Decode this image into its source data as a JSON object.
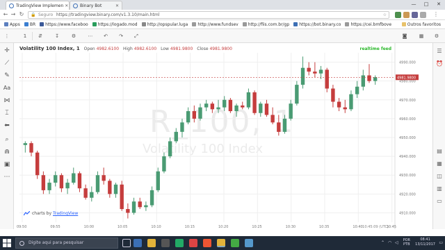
{
  "browser": {
    "tabs": [
      {
        "label": "TradingView Implemen",
        "active": true
      },
      {
        "label": "Binary Bot",
        "active": false
      }
    ],
    "secure_label": "Seguro",
    "url": "https://tradingview.binary.com/v1.3.10/main.html",
    "window_controls": [
      "—",
      "□",
      "✕"
    ]
  },
  "bookmarks": {
    "items": [
      "Apps",
      "BR",
      "https://www.faceboo",
      "https://logado.mod",
      "http://opspular.luga",
      "http://www.fundsev",
      "http://fiis.com.br/gp",
      "https://bot.binary.co",
      "https://cei.bmfbove"
    ],
    "right": "Outros favoritos"
  },
  "chart_toolbar": {
    "interval": "1",
    "symbols": [
      "⇵",
      "↧",
      "⚙",
      "⋯",
      "⤢"
    ]
  },
  "chart": {
    "legend": {
      "symbol": "Volatility 100 Index, 1",
      "open_label": "Open",
      "open": "4982.6100",
      "high_label": "High",
      "high": "4982.6100",
      "low_label": "Low",
      "low": "4981.9800",
      "close_label": "Close",
      "close": "4981.9800"
    },
    "realtime": "realtime feed",
    "watermark_symbol": "R_100, 1",
    "watermark_name": "Volatility 100 Index",
    "brand_prefix": "charts by",
    "brand_name": "TradingView",
    "timestamp": "10:45:09 (UTC)",
    "last_price_label": "4981.9800"
  },
  "chart_data": {
    "type": "candlestick",
    "title": "Volatility 100 Index, 1",
    "x_ticks": [
      "09:50",
      "09:55",
      "10:00",
      "10:05",
      "10:10",
      "10:15",
      "10:20",
      "10:25",
      "10:30",
      "10:35",
      "10:40",
      "10:45"
    ],
    "y_ticks": [
      4990,
      4980,
      4970,
      4960,
      4950,
      4940,
      4930,
      4920,
      4910
    ],
    "ylim": [
      4905,
      4995
    ],
    "last_price": 4981.98,
    "candles": [
      {
        "o": 4946,
        "h": 4948,
        "l": 4942,
        "c": 4947
      },
      {
        "o": 4947,
        "h": 4948,
        "l": 4940,
        "c": 4942
      },
      {
        "o": 4942,
        "h": 4943,
        "l": 4928,
        "c": 4930
      },
      {
        "o": 4930,
        "h": 4932,
        "l": 4920,
        "c": 4922
      },
      {
        "o": 4922,
        "h": 4928,
        "l": 4920,
        "c": 4926
      },
      {
        "o": 4926,
        "h": 4932,
        "l": 4924,
        "c": 4930
      },
      {
        "o": 4930,
        "h": 4931,
        "l": 4921,
        "c": 4923
      },
      {
        "o": 4923,
        "h": 4928,
        "l": 4920,
        "c": 4926
      },
      {
        "o": 4926,
        "h": 4934,
        "l": 4925,
        "c": 4931
      },
      {
        "o": 4931,
        "h": 4932,
        "l": 4921,
        "c": 4923
      },
      {
        "o": 4923,
        "h": 4925,
        "l": 4917,
        "c": 4918
      },
      {
        "o": 4918,
        "h": 4924,
        "l": 4916,
        "c": 4921
      },
      {
        "o": 4921,
        "h": 4932,
        "l": 4920,
        "c": 4930
      },
      {
        "o": 4930,
        "h": 4934,
        "l": 4925,
        "c": 4927
      },
      {
        "o": 4927,
        "h": 4928,
        "l": 4918,
        "c": 4920
      },
      {
        "o": 4920,
        "h": 4926,
        "l": 4918,
        "c": 4925
      },
      {
        "o": 4925,
        "h": 4927,
        "l": 4911,
        "c": 4912
      },
      {
        "o": 4912,
        "h": 4915,
        "l": 4907,
        "c": 4910
      },
      {
        "o": 4910,
        "h": 4918,
        "l": 4909,
        "c": 4916
      },
      {
        "o": 4916,
        "h": 4918,
        "l": 4912,
        "c": 4913
      },
      {
        "o": 4913,
        "h": 4916,
        "l": 4911,
        "c": 4914
      },
      {
        "o": 4914,
        "h": 4924,
        "l": 4913,
        "c": 4922
      },
      {
        "o": 4922,
        "h": 4934,
        "l": 4921,
        "c": 4932
      },
      {
        "o": 4932,
        "h": 4942,
        "l": 4931,
        "c": 4940
      },
      {
        "o": 4940,
        "h": 4950,
        "l": 4939,
        "c": 4948
      },
      {
        "o": 4948,
        "h": 4955,
        "l": 4947,
        "c": 4953
      },
      {
        "o": 4953,
        "h": 4960,
        "l": 4950,
        "c": 4958
      },
      {
        "o": 4958,
        "h": 4966,
        "l": 4957,
        "c": 4964
      },
      {
        "o": 4964,
        "h": 4967,
        "l": 4958,
        "c": 4960
      },
      {
        "o": 4960,
        "h": 4968,
        "l": 4959,
        "c": 4966
      },
      {
        "o": 4966,
        "h": 4970,
        "l": 4964,
        "c": 4968
      },
      {
        "o": 4968,
        "h": 4969,
        "l": 4963,
        "c": 4965
      },
      {
        "o": 4965,
        "h": 4970,
        "l": 4963,
        "c": 4966
      },
      {
        "o": 4966,
        "h": 4972,
        "l": 4964,
        "c": 4970
      },
      {
        "o": 4970,
        "h": 4971,
        "l": 4963,
        "c": 4964
      },
      {
        "o": 4964,
        "h": 4968,
        "l": 4961,
        "c": 4967
      },
      {
        "o": 4967,
        "h": 4969,
        "l": 4965,
        "c": 4966
      },
      {
        "o": 4966,
        "h": 4976,
        "l": 4965,
        "c": 4974
      },
      {
        "o": 4974,
        "h": 4975,
        "l": 4962,
        "c": 4963
      },
      {
        "o": 4963,
        "h": 4969,
        "l": 4961,
        "c": 4968
      },
      {
        "o": 4968,
        "h": 4970,
        "l": 4961,
        "c": 4962
      },
      {
        "o": 4962,
        "h": 4966,
        "l": 4957,
        "c": 4958
      },
      {
        "o": 4958,
        "h": 4962,
        "l": 4951,
        "c": 4953
      },
      {
        "o": 4953,
        "h": 4962,
        "l": 4952,
        "c": 4960
      },
      {
        "o": 4960,
        "h": 4970,
        "l": 4959,
        "c": 4968
      },
      {
        "o": 4968,
        "h": 4980,
        "l": 4967,
        "c": 4978
      },
      {
        "o": 4978,
        "h": 4993,
        "l": 4976,
        "c": 4987
      },
      {
        "o": 4987,
        "h": 4990,
        "l": 4983,
        "c": 4985
      },
      {
        "o": 4985,
        "h": 4990,
        "l": 4982,
        "c": 4984
      },
      {
        "o": 4984,
        "h": 4988,
        "l": 4981,
        "c": 4986
      },
      {
        "o": 4986,
        "h": 4987,
        "l": 4974,
        "c": 4976
      },
      {
        "o": 4976,
        "h": 4978,
        "l": 4966,
        "c": 4969
      },
      {
        "o": 4969,
        "h": 4971,
        "l": 4964,
        "c": 4966
      },
      {
        "o": 4966,
        "h": 4970,
        "l": 4963,
        "c": 4965
      },
      {
        "o": 4965,
        "h": 4975,
        "l": 4964,
        "c": 4973
      },
      {
        "o": 4973,
        "h": 4980,
        "l": 4971,
        "c": 4977
      },
      {
        "o": 4977,
        "h": 4986,
        "l": 4975,
        "c": 4983
      },
      {
        "o": 4983,
        "h": 4989,
        "l": 4979,
        "c": 4980
      },
      {
        "o": 4980,
        "h": 4983,
        "l": 4978,
        "c": 4982
      }
    ]
  },
  "taskbar": {
    "search_placeholder": "Digite aqui para pesquisar",
    "lang_top": "POR",
    "lang_bottom": "PTB",
    "time": "08:41",
    "date": "13/11/2017"
  },
  "colors": {
    "up": "#4a9b73",
    "down": "#c53d3d",
    "grid": "#efefef"
  }
}
